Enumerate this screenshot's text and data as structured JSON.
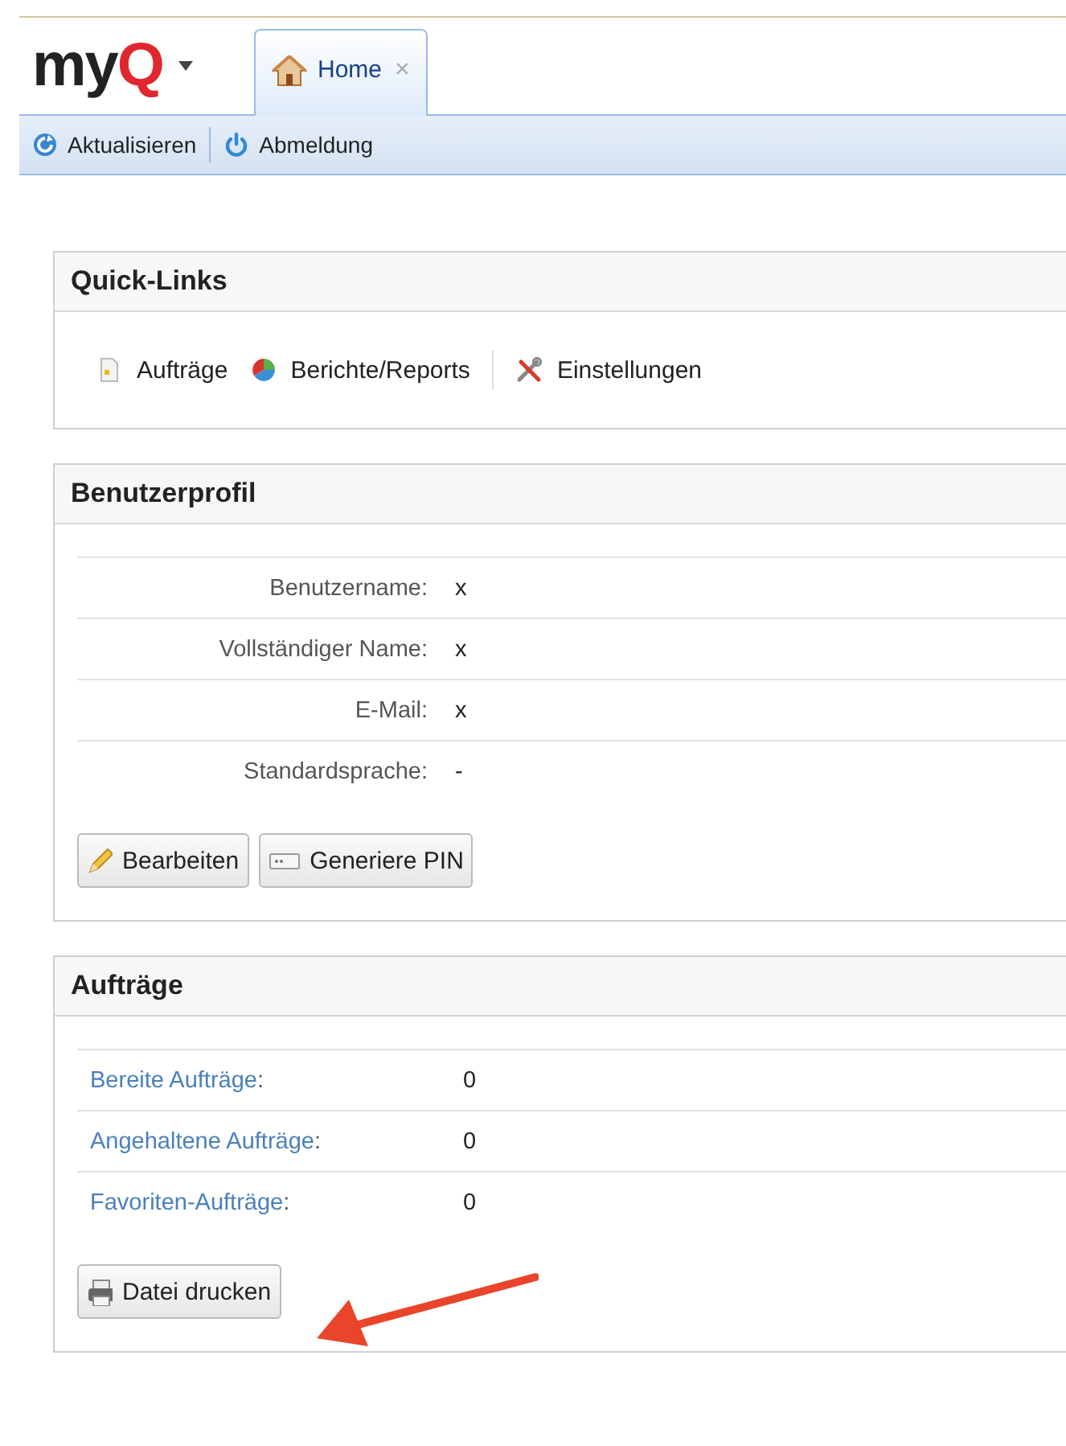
{
  "logo": [
    "my",
    "Q"
  ],
  "tabs": [
    {
      "label": "Home",
      "selected": true,
      "close": "×"
    }
  ],
  "toolbar": [
    {
      "kind": "refresh",
      "label": "Aktualisieren"
    },
    {
      "kind": "logout",
      "label": "Abmeldung"
    }
  ],
  "quick_links": {
    "title": "Quick-Links",
    "items": [
      {
        "kind": "jobs",
        "label": "Aufträge"
      },
      {
        "kind": "reports",
        "label": "Berichte/Reports"
      },
      {
        "kind": "settings",
        "label": "Einstellungen"
      }
    ]
  },
  "profile": {
    "title": "Benutzerprofil",
    "fields": [
      {
        "label": "Benutzername:",
        "value": "x"
      },
      {
        "label": "Vollständiger Name:",
        "value": "x"
      },
      {
        "label": "E-Mail:",
        "value": "x"
      },
      {
        "label": "Standardsprache:",
        "value": "-"
      }
    ],
    "buttons": [
      {
        "kind": "edit",
        "label": "Bearbeiten"
      },
      {
        "kind": "pin",
        "label": "Generiere PIN"
      }
    ]
  },
  "jobs": {
    "title": "Aufträge",
    "rows": [
      {
        "label": "Bereite Aufträge",
        "suffix": ":",
        "value": "0"
      },
      {
        "label": "Angehaltene Aufträge",
        "suffix": ":",
        "value": "0"
      },
      {
        "label": "Favoriten-Aufträge",
        "suffix": ":",
        "value": "0"
      }
    ],
    "buttons": [
      {
        "kind": "print",
        "label": "Datei drucken"
      }
    ]
  },
  "annotation": {
    "kind": "arrow"
  }
}
